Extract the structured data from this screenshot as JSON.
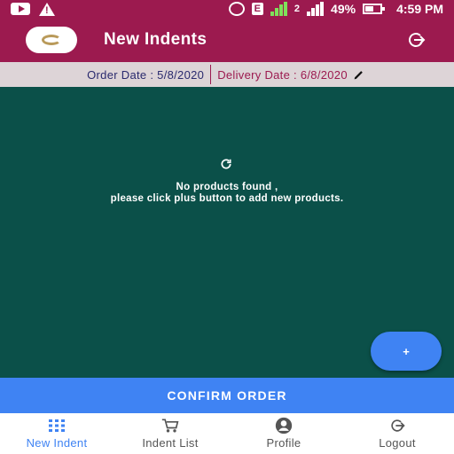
{
  "status_bar": {
    "battery_percent": "49%",
    "time": "4:59 PM",
    "network_label": "E",
    "sim_slot": "2",
    "icons": [
      "youtube-icon",
      "warning-icon",
      "alarm-icon",
      "signal-icon",
      "battery-icon"
    ]
  },
  "app_bar": {
    "title": "New Indents",
    "logout_icon": "logout-icon"
  },
  "dates": {
    "order_date": "Order Date : 5/8/2020",
    "delivery_date": "Delivery Date : 6/8/2020",
    "edit_icon": "pencil-icon"
  },
  "content": {
    "empty_line1": "No products found ,",
    "empty_line2": "please click plus button to add new products."
  },
  "fab": {
    "label": "+"
  },
  "confirm": {
    "label": "CONFIRM ORDER"
  },
  "bottom_nav": {
    "items": [
      {
        "label": "New Indent",
        "icon": "grid-icon",
        "active": true
      },
      {
        "label": "Indent List",
        "icon": "cart-icon",
        "active": false
      },
      {
        "label": "Profile",
        "icon": "profile-icon",
        "active": false
      },
      {
        "label": "Logout",
        "icon": "logout-icon",
        "active": false
      }
    ]
  },
  "colors": {
    "primary": "#9c1a4f",
    "content_bg": "#0b5049",
    "accent": "#3f83f3",
    "date_strip_bg": "#ddd4d7"
  }
}
